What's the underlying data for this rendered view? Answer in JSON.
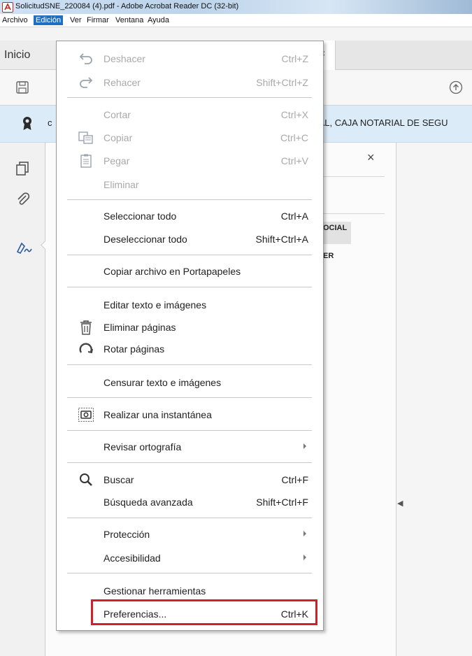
{
  "window": {
    "title": "SolicitudSNE_220084 (4).pdf - Adobe Acrobat Reader DC (32-bit)"
  },
  "menubar": [
    "Archivo",
    "Edición",
    "Ver",
    "Firmar",
    "Ventana",
    "Ayuda"
  ],
  "tabs": {
    "home": "Inicio",
    "close": "×"
  },
  "notification": {
    "text": "IAL, CAJA NOTARIAL DE SEGU"
  },
  "panel": {
    "close": "×",
    "item1": "OCIAL",
    "item2": "ER"
  },
  "menu": {
    "items": [
      {
        "label": "Deshacer",
        "shortcut": "Ctrl+Z",
        "icon": "undo-icon"
      },
      {
        "label": "Rehacer",
        "shortcut": "Shift+Ctrl+Z",
        "icon": "redo-icon"
      },
      {
        "label": "Cortar",
        "shortcut": "Ctrl+X"
      },
      {
        "label": "Copiar",
        "shortcut": "Ctrl+C",
        "icon": "copy-icon"
      },
      {
        "label": "Pegar",
        "shortcut": "Ctrl+V",
        "icon": "paste-icon"
      },
      {
        "label": "Eliminar"
      },
      {
        "label": "Seleccionar todo",
        "shortcut": "Ctrl+A"
      },
      {
        "label": "Deseleccionar todo",
        "shortcut": "Shift+Ctrl+A"
      },
      {
        "label": "Copiar archivo en Portapapeles"
      },
      {
        "label": "Editar texto e imágenes"
      },
      {
        "label": "Eliminar páginas",
        "icon": "trash-icon"
      },
      {
        "label": "Rotar páginas",
        "icon": "rotate-icon"
      },
      {
        "label": "Censurar texto e imágenes"
      },
      {
        "label": "Realizar una instantánea",
        "icon": "snapshot-icon"
      },
      {
        "label": "Revisar ortografía",
        "submenu": true
      },
      {
        "label": "Buscar",
        "shortcut": "Ctrl+F",
        "icon": "search-icon"
      },
      {
        "label": "Búsqueda avanzada",
        "shortcut": "Shift+Ctrl+F"
      },
      {
        "label": "Protección",
        "submenu": true
      },
      {
        "label": "Accesibilidad",
        "submenu": true
      },
      {
        "label": "Gestionar herramientas"
      },
      {
        "label": "Preferencias...",
        "shortcut": "Ctrl+K"
      }
    ]
  },
  "colors": {
    "highlight": "#d0202a",
    "menubar_active": "#1f6fc5",
    "disabled_text": "#a9a9a9"
  }
}
